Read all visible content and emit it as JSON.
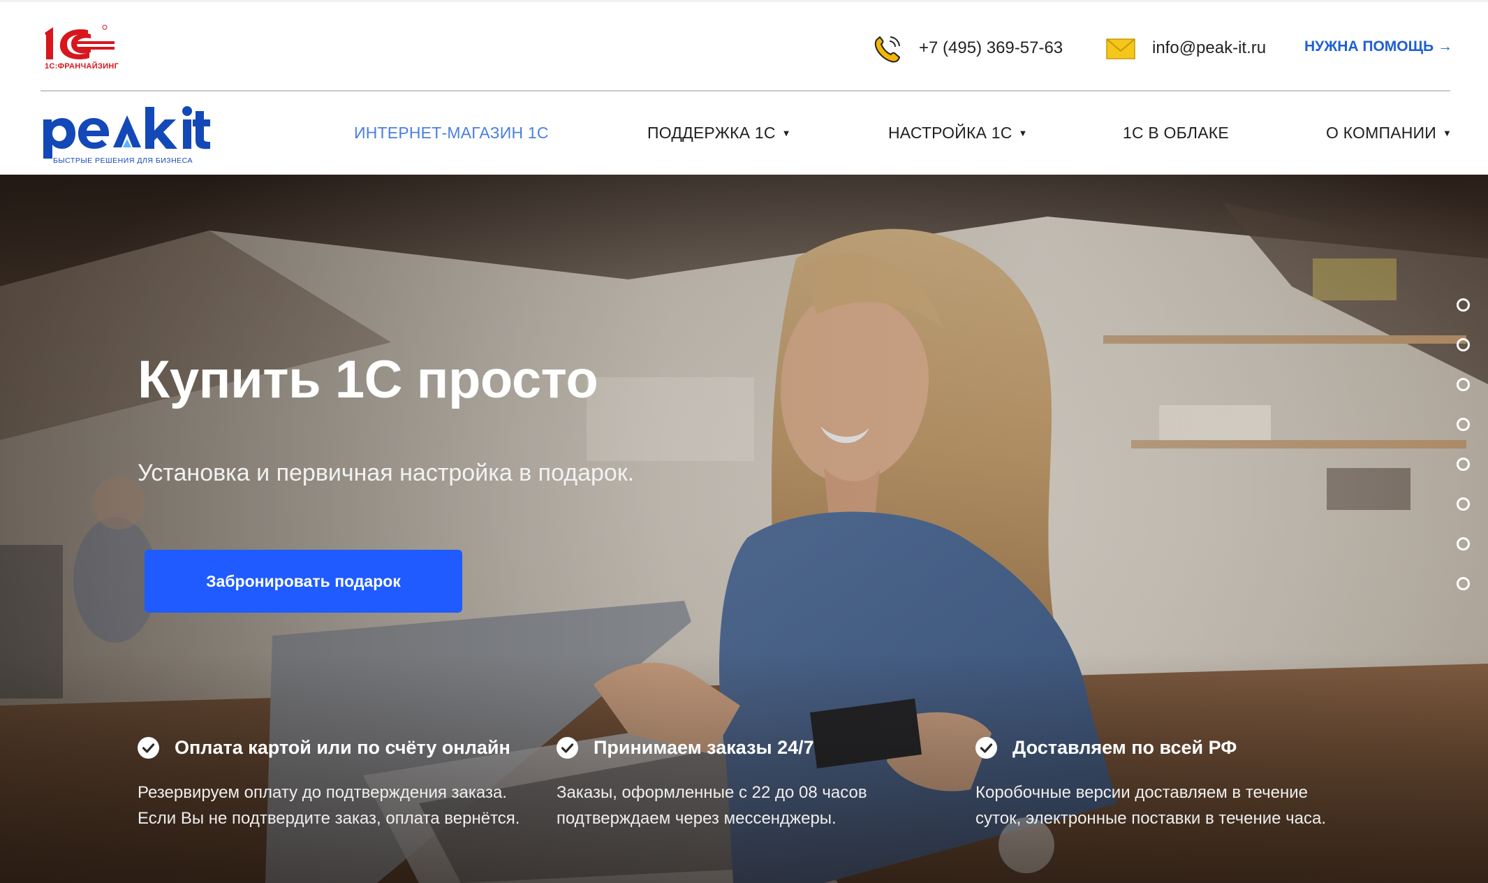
{
  "header": {
    "franchise_logo_caption": "1С:ФРАНЧАЙЗИНГ",
    "phone": "+7 (495) 369-57-63",
    "email": "info@peak-it.ru",
    "help_link": "НУЖНА ПОМОЩЬ →"
  },
  "brand": {
    "name": "peak it",
    "tagline": "БЫСТРЫЕ РЕШЕНИЯ ДЛЯ БИЗНЕСА"
  },
  "nav": {
    "items": [
      {
        "label": "ИНТЕРНЕТ-МАГАЗИН 1С",
        "has_dropdown": false,
        "active": true
      },
      {
        "label": "ПОДДЕРЖКА 1С",
        "has_dropdown": true,
        "active": false
      },
      {
        "label": "НАСТРОЙКА 1С",
        "has_dropdown": true,
        "active": false
      },
      {
        "label": "1С В ОБЛАКЕ",
        "has_dropdown": false,
        "active": false
      },
      {
        "label": "О КОМПАНИИ",
        "has_dropdown": true,
        "active": false
      }
    ]
  },
  "hero": {
    "title": "Купить 1С просто",
    "subtitle": "Установка и первичная настройка в подарок.",
    "cta_label": "Забронировать подарок",
    "slide_count": 8
  },
  "features": [
    {
      "title": "Оплата картой или по счёту онлайн",
      "lines": [
        "Резервируем оплату до подтверждения заказа.",
        "Если Вы не подтвердите заказ, оплата вернётся."
      ]
    },
    {
      "title": "Принимаем заказы 24/7",
      "lines": [
        "Заказы, оформленные с 22 до 08 часов",
        "подтверждаем через мессенджеры."
      ]
    },
    {
      "title": "Доставляем по всей РФ",
      "lines": [
        "Коробочные версии доставляем в течение",
        "суток, электронные поставки в течение часа."
      ]
    }
  ],
  "colors": {
    "accent_blue": "#1f5bff",
    "link_blue": "#1e5fd6",
    "active_nav": "#4a7fe0",
    "brand_blue": "#1348b8",
    "franchise_red": "#d7161d"
  },
  "icons": {
    "phone": "phone-icon",
    "mail": "envelope-icon",
    "check": "check-circle-icon",
    "caret": "caret-down-icon"
  }
}
